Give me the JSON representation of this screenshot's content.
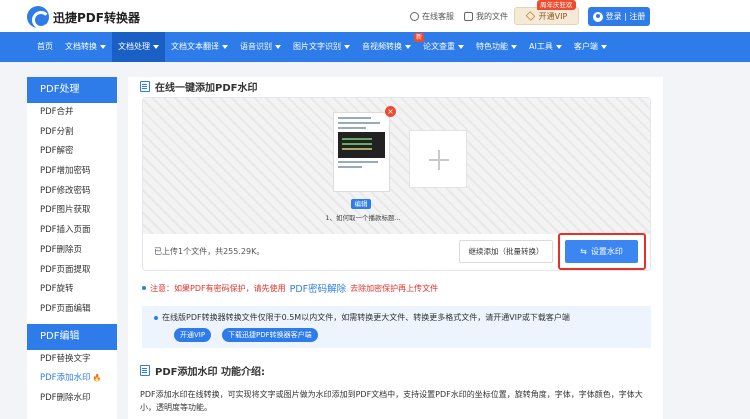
{
  "header": {
    "brand": "迅捷PDF转换器",
    "service_label": "在线客服",
    "docs_label": "我的文件",
    "vip_label": "开通VIP",
    "vip_tag": "周年庆狂欢",
    "login_label": "登录 | 注册"
  },
  "nav": {
    "items": [
      {
        "label": "首页",
        "caret": false
      },
      {
        "label": "文档转换",
        "caret": true
      },
      {
        "label": "文档处理",
        "caret": true
      },
      {
        "label": "文档文本翻译",
        "caret": true
      },
      {
        "label": "语音识别",
        "caret": true
      },
      {
        "label": "图片文字识别",
        "caret": true
      },
      {
        "label": "音视频转换",
        "caret": true
      },
      {
        "label": "论文查重",
        "caret": true
      },
      {
        "label": "特色功能",
        "caret": true
      },
      {
        "label": "AI工具",
        "caret": true
      },
      {
        "label": "客户端",
        "caret": true
      }
    ],
    "active_index": 2,
    "new_tag": "新"
  },
  "sidebar": {
    "group1_title": "PDF处理",
    "group1_items": [
      "PDF合并",
      "PDF分割",
      "PDF解密",
      "PDF增加密码",
      "PDF修改密码",
      "PDF图片获取",
      "PDF插入页面",
      "PDF删除页",
      "PDF页面提取",
      "PDF旋转",
      "PDF页面编辑"
    ],
    "group2_title": "PDF编辑",
    "group2_items": [
      "PDF替换文字",
      "PDF添加水印",
      "PDF删除水印"
    ],
    "active_item": "PDF添加水印"
  },
  "main": {
    "title": "在线一键添加PDF水印",
    "file": {
      "edit_label": "编辑",
      "name": "1、如何取一个播款标题..."
    },
    "uploaded_status": "已上传1个文件，共255.29K。",
    "continue_button": "继续添加（批量转换）",
    "set_watermark_button": "设置水印",
    "notice_prefix": "注意：如果PDF有密码保护，请先使用",
    "notice_link": "PDF密码解除",
    "notice_suffix": "去除加密保护再上传文件",
    "info_text": "在线版PDF转换器转换文件仅限于0.5M以内文件，如需转换更大文件、转换更多格式文件，请开通VIP或下载客户端",
    "pill_vip": "开通VIP",
    "pill_download": "下载迅捷PDF转换器客户端",
    "intro_title": "PDF添加水印 功能介绍:",
    "intro_text": "PDF添加水印在线转换，可实现将文字或图片做为水印添加到PDF文档中，支持设置PDF水印的坐标位置，旋转角度，字体，字体颜色，字体大小，透明度等功能。"
  },
  "colors": {
    "brand_blue": "#2e7ce9",
    "highlight_red": "#e7302a"
  }
}
